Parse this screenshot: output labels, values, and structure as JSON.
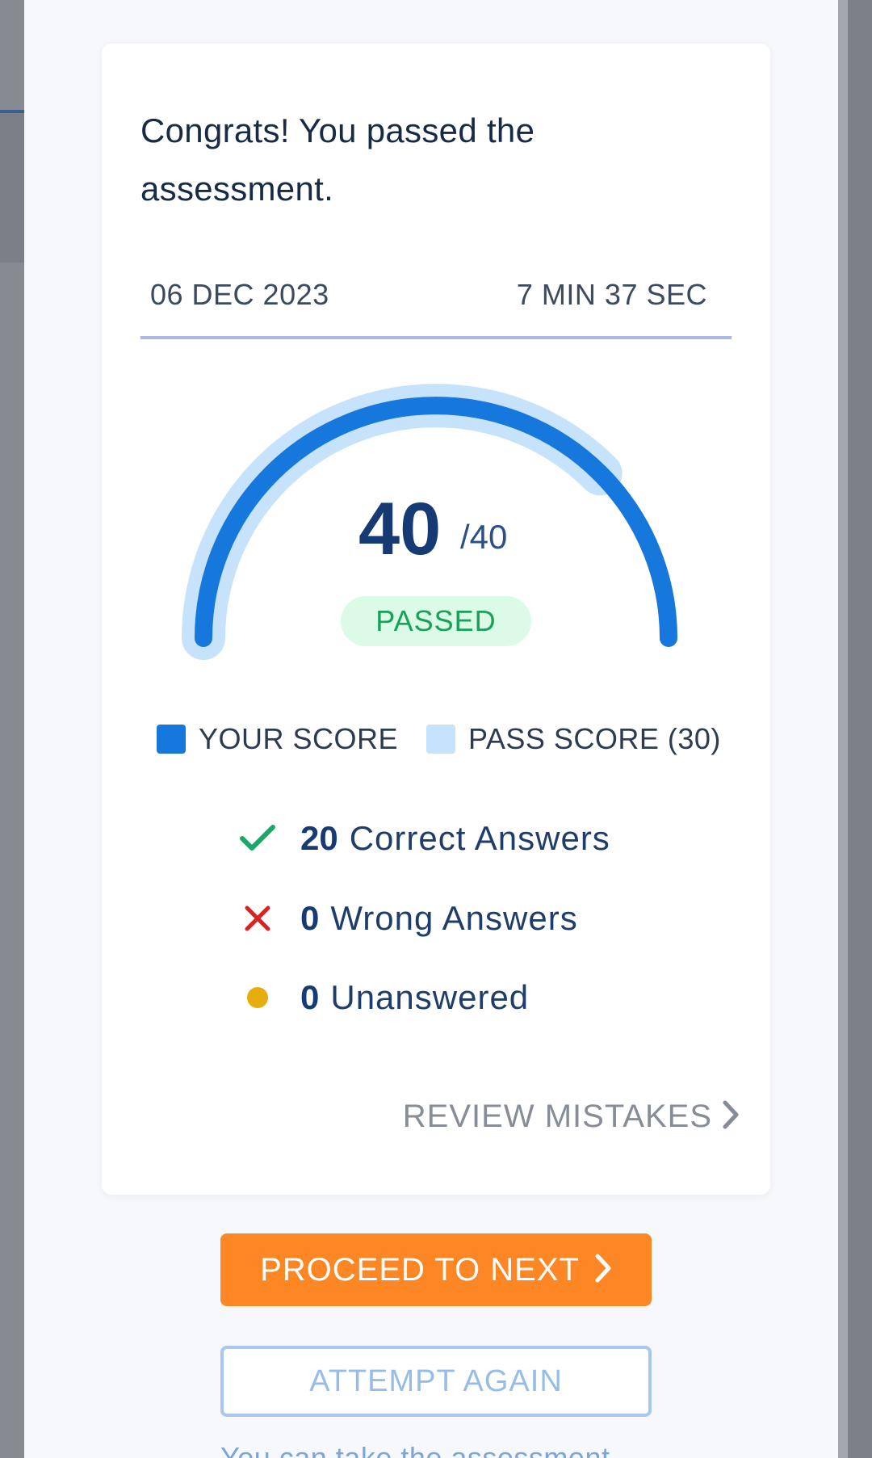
{
  "result": {
    "headline": "Congrats! You passed the assessment.",
    "date": "06 DEC 2023",
    "duration": "7 MIN 37 SEC",
    "score": "40",
    "score_total": "/40",
    "status": "PASSED",
    "score_fraction": 1.0,
    "pass_fraction": 0.75
  },
  "legend": {
    "your_score": "YOUR SCORE",
    "pass_score": "PASS SCORE (30)"
  },
  "stats": [
    {
      "count": "20",
      "label": "Correct Answers",
      "icon": "check-icon"
    },
    {
      "count": "0",
      "label": "Wrong Answers",
      "icon": "cross-icon"
    },
    {
      "count": "0",
      "label": "Unanswered",
      "icon": "dot-icon"
    }
  ],
  "actions": {
    "review": "REVIEW MISTAKES",
    "proceed": "PROCEED TO NEXT",
    "attempt": "ATTEMPT AGAIN",
    "footnote": "You can take the assessment"
  },
  "colors": {
    "accent": "#1677dd",
    "pass_track": "#c7e3fb",
    "passed_text": "#19a05a",
    "proceed_button": "#fd8625"
  }
}
